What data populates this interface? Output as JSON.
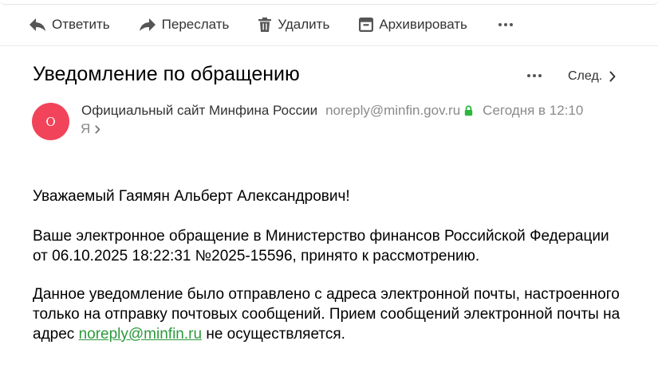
{
  "toolbar": {
    "reply": {
      "label": "Ответить",
      "icon": "reply-icon"
    },
    "forward": {
      "label": "Переслать",
      "icon": "forward-icon"
    },
    "delete": {
      "label": "Удалить",
      "icon": "trash-icon"
    },
    "archive": {
      "label": "Архивировать",
      "icon": "archive-icon"
    },
    "more": {
      "icon": "more-dots-icon"
    }
  },
  "message": {
    "subject": "Уведомление по обращению",
    "next_label": "След.",
    "sender": {
      "avatar_letter": "О",
      "avatar_color": "#f1445a",
      "name": "Официальный сайт Минфина России",
      "email": "noreply@minfin.gov.ru",
      "secure_icon": "lock-icon",
      "secure_color": "#2db83d",
      "time": "Сегодня в 12:10"
    },
    "recipient": "Я",
    "body": {
      "greeting": "Уважаемый Гаямян Альберт Александрович!",
      "paragraph1": "Ваше электронное обращение в Министерство финансов Российской Федерации от 06.10.2025 18:22:31 №2025-15596, принято к рассмотрению.",
      "paragraph2_before": "Данное уведомление было отправлено с адреса электронной почты, настроенного только на отправку почтовых сообщений. Прием сообщений электронной почты на адрес ",
      "paragraph2_link": "noreply@minfin.ru",
      "paragraph2_after": " не осуществляется.",
      "link_color": "#2c9a3c"
    }
  }
}
